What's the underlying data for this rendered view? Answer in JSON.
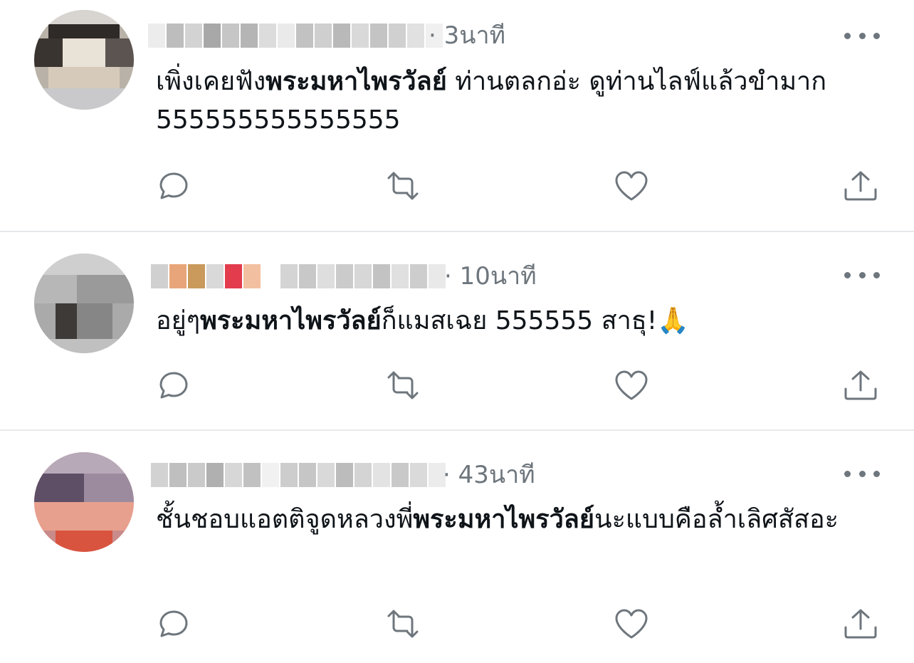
{
  "tweets": [
    {
      "time": "· 3นาที",
      "text_before": "เพิ่งเคยฟัง",
      "text_bold": "พระมหาไพรวัลย์",
      "text_after": " ท่านตลกอ่ะ ดูท่านไลฟ์แล้วขำมาก 555555555555555",
      "emoji": ""
    },
    {
      "time": "· 10นาที",
      "text_before": "อยู่ๆ",
      "text_bold": "พระมหาไพรวัลย์",
      "text_after": "ก็แมสเฉย 555555 สาธุ!",
      "emoji": "🙏"
    },
    {
      "time": "· 43นาที",
      "text_before": "ชั้นชอบแอตติจูดหลวงพี่",
      "text_bold": "พระมหาไพรวัลย์",
      "text_after": "นะแบบคือล้ำเลิศสัสอะ",
      "emoji": ""
    }
  ],
  "icons": {
    "reply": "reply-icon",
    "retweet": "retweet-icon",
    "like": "heart-icon",
    "share": "share-icon",
    "more": "more-options-icon"
  },
  "colors": {
    "text": "#0f1419",
    "secondary": "#6e767d",
    "divider": "#e7e9eb"
  }
}
